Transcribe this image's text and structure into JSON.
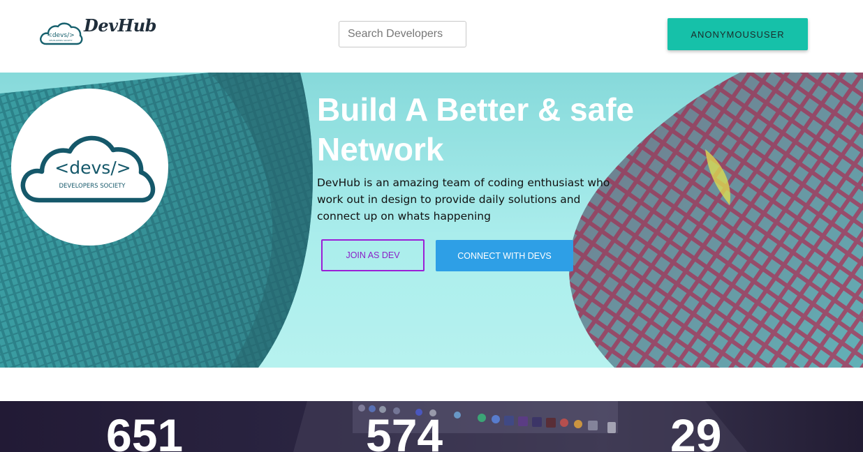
{
  "navbar": {
    "brand_name": "DevHub",
    "logo_text": "<devs/>",
    "logo_subtext": "DEVELOPERS SOCIETY",
    "search_placeholder": "Search Developers",
    "user_button": "ANONYMOUSUSER"
  },
  "hero": {
    "logo_text": "<devs/>",
    "logo_subtext": "DEVELOPERS SOCIETY",
    "title_line1": "Build A Better & safe",
    "title_line2": "Network",
    "description": "DevHub is an amazing team of coding enthusiast who work out in design to provide daily solutions and connect up on whats happening",
    "join_button": "JOIN AS DEV",
    "connect_button": "CONNECT WITH DEVS"
  },
  "stats": {
    "items": [
      {
        "value": "651"
      },
      {
        "value": "574"
      },
      {
        "value": "29"
      }
    ]
  },
  "colors": {
    "accent_teal": "#16c1a9",
    "join_purple": "#9b1fd6",
    "connect_blue": "#2e9fe6"
  }
}
